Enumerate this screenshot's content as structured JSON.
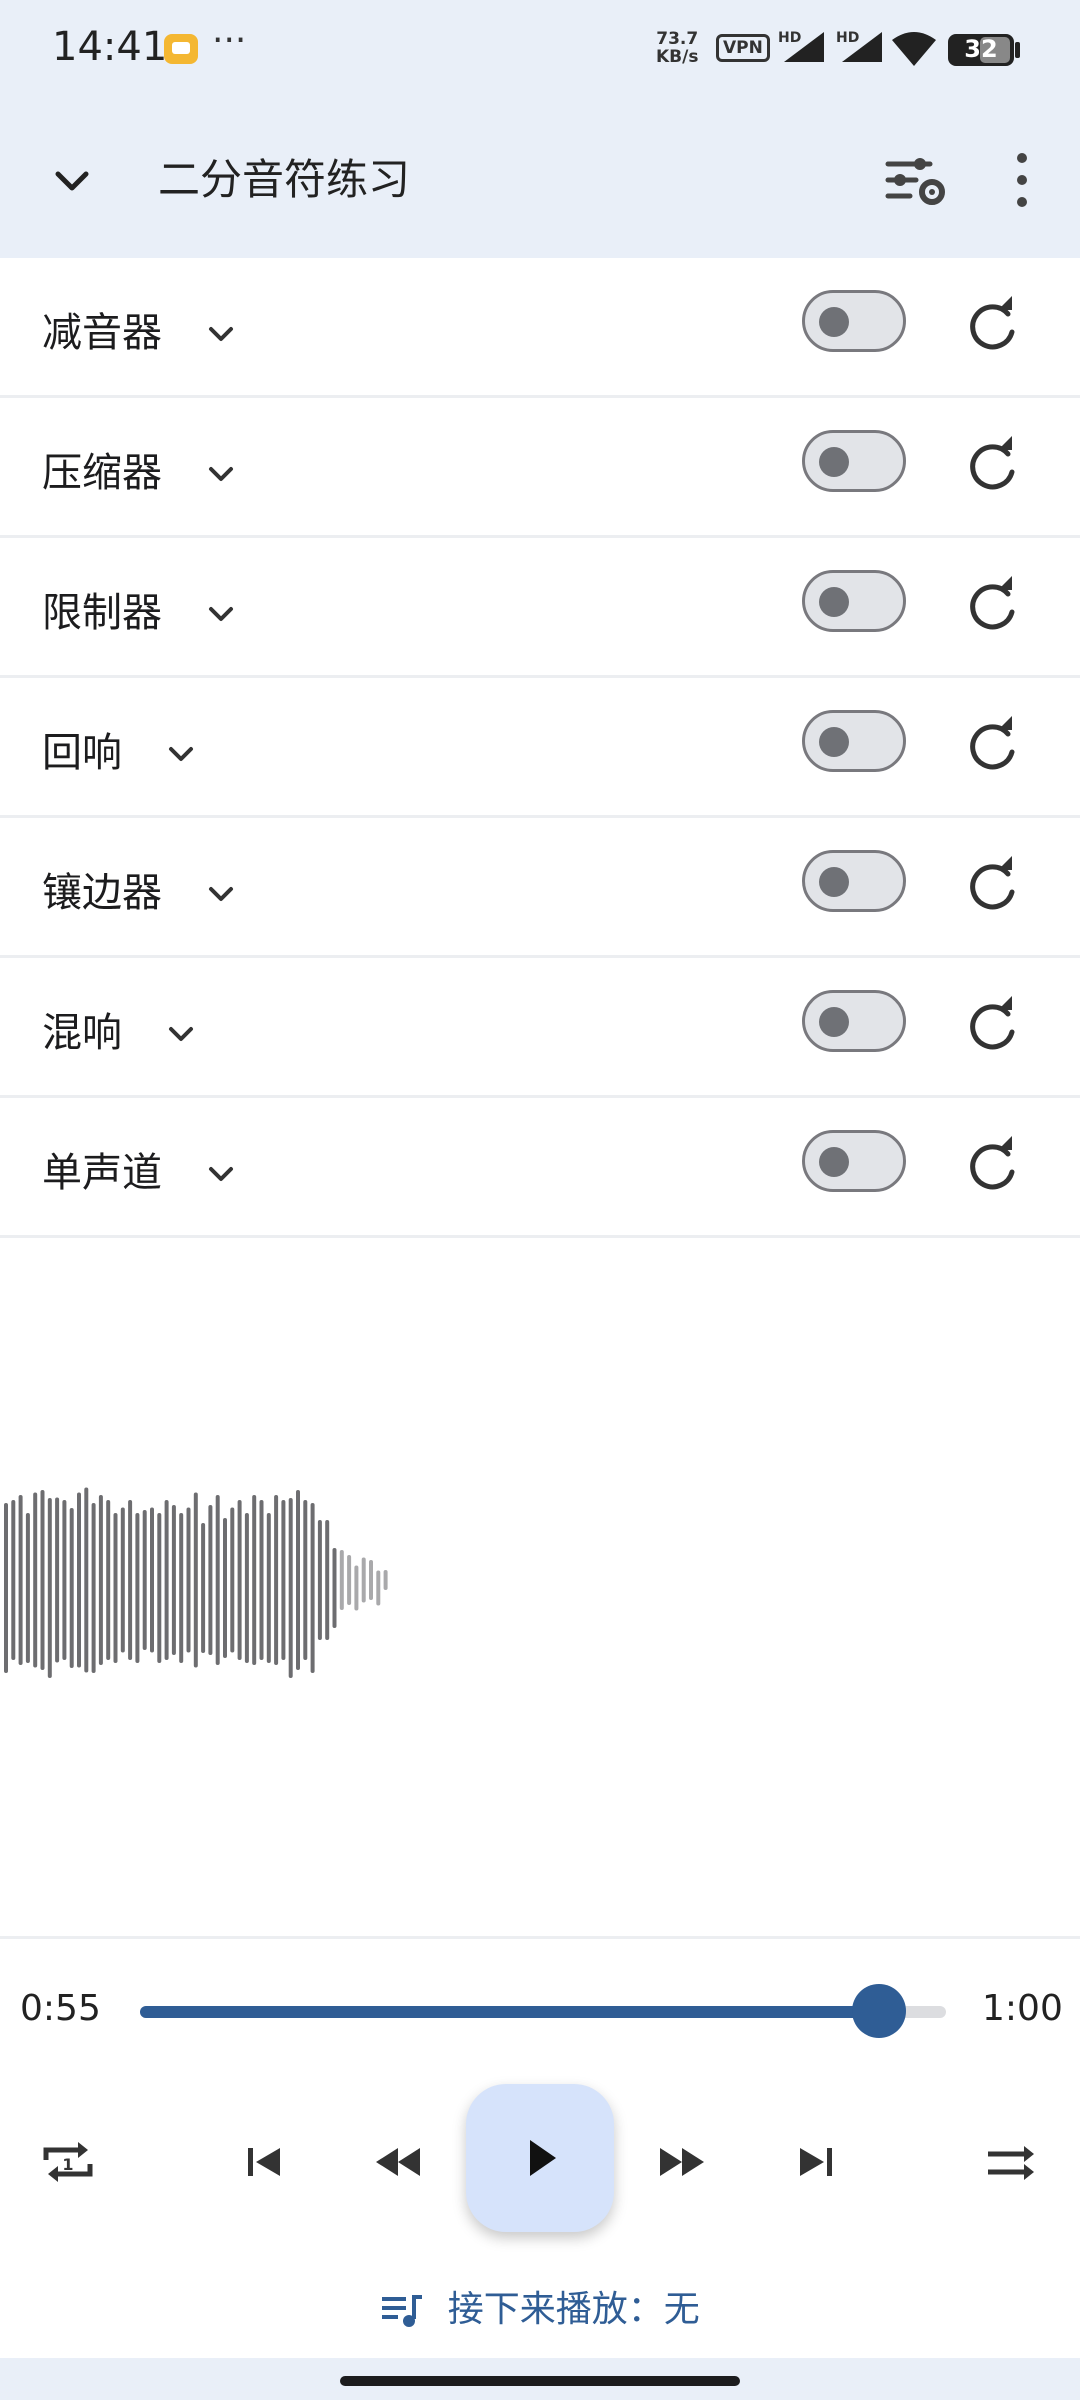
{
  "status_bar": {
    "time": "14:41",
    "speed_value": "73.7",
    "speed_unit": "KB/s",
    "vpn": "VPN",
    "hd1": "HD",
    "hd2": "HD",
    "battery": "32",
    "more": "···"
  },
  "appbar": {
    "title": "二分音符练习"
  },
  "effects": [
    {
      "label": "减音器",
      "enabled": false
    },
    {
      "label": "压缩器",
      "enabled": false
    },
    {
      "label": "限制器",
      "enabled": false
    },
    {
      "label": "回响",
      "enabled": false
    },
    {
      "label": "镶边器",
      "enabled": false
    },
    {
      "label": "混响",
      "enabled": false
    },
    {
      "label": "单声道",
      "enabled": false
    }
  ],
  "player": {
    "current_time": "0:55",
    "total_time": "1:00",
    "progress": 0.917,
    "up_next": "接下来播放：无"
  },
  "colors": {
    "accent": "#2f5d95",
    "header_bg": "#e9eff8",
    "play_bg": "#d6e3fb"
  }
}
